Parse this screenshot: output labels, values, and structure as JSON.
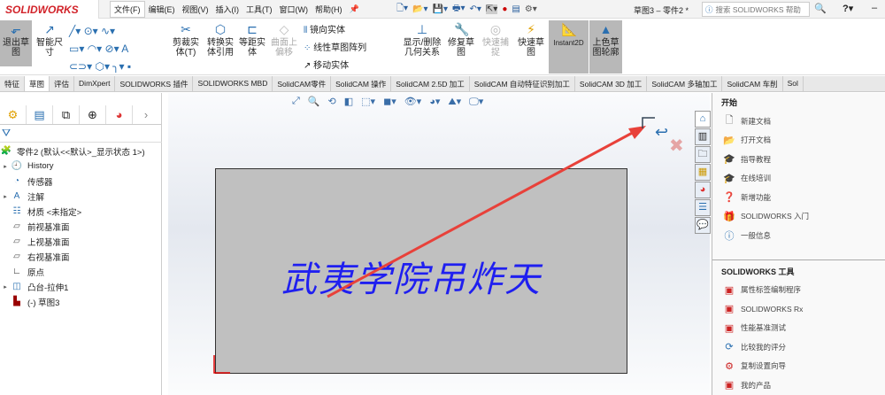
{
  "app": {
    "logo": "SOLIDWORKS",
    "doc_title": "草图3 – 零件2 *",
    "search_placeholder": "搜索 SOLIDWORKS 帮助"
  },
  "menu": [
    "文件(F)",
    "编辑(E)",
    "视图(V)",
    "插入(I)",
    "工具(T)",
    "窗口(W)",
    "帮助(H)"
  ],
  "ribbon": {
    "exit_sketch": "退出草图",
    "smart_dim": "智能尺寸",
    "trim": "剪裁实体(T)",
    "convert": "转换实体引用",
    "offset": "等距实体",
    "surface_offset": "曲面上偏移",
    "mirror": "镜向实体",
    "linear_pattern": "线性草图阵列",
    "move": "移动实体",
    "show_relations": "显示/删除几何关系",
    "repair": "修复草图",
    "quick_snap": "快速捕捉",
    "rapid_sketch": "快速草图",
    "instant2d": "Instant2D",
    "shaded": "上色草图轮廓"
  },
  "tabs": [
    "特征",
    "草图",
    "评估",
    "DimXpert",
    "SOLIDWORKS 插件",
    "SOLIDWORKS MBD",
    "SolidCAM零件",
    "SolidCAM 操作",
    "SolidCAM 2.5D 加工",
    "SolidCAM 自动特征识别加工",
    "SolidCAM 3D 加工",
    "SolidCAM 多轴加工",
    "SolidCAM 车削",
    "Sol"
  ],
  "tree": [
    {
      "label": "零件2 (默认<<默认>_显示状态 1>)",
      "icon": "part",
      "exp": false
    },
    {
      "label": "History",
      "icon": "history",
      "exp": true
    },
    {
      "label": "传感器",
      "icon": "sensor",
      "exp": false
    },
    {
      "label": "注解",
      "icon": "annotation",
      "exp": true
    },
    {
      "label": "材质 <未指定>",
      "icon": "material",
      "exp": false
    },
    {
      "label": "前视基准面",
      "icon": "plane",
      "exp": false
    },
    {
      "label": "上视基准面",
      "icon": "plane",
      "exp": false
    },
    {
      "label": "右视基准面",
      "icon": "plane",
      "exp": false
    },
    {
      "label": "原点",
      "icon": "origin",
      "exp": false
    },
    {
      "label": "凸台-拉伸1",
      "icon": "extrude",
      "exp": true
    },
    {
      "label": "(-) 草图3",
      "icon": "sketch",
      "exp": false
    }
  ],
  "canvas": {
    "sketch_text": "武夷学院吊炸天",
    "arrow_color": "#e8413a",
    "text_color": "#1f1ff0"
  },
  "task": {
    "start_title": "开始",
    "start": [
      "新建文档",
      "打开文档",
      "指导教程",
      "在线培训",
      "新增功能",
      "SOLIDWORKS 入门",
      "一般信息"
    ],
    "tools_title": "SOLIDWORKS 工具",
    "tools": [
      "属性标签编制程序",
      "SOLIDWORKS Rx",
      "性能基准测试",
      "比较我的评分",
      "复制设置向导",
      "我的产品"
    ]
  }
}
